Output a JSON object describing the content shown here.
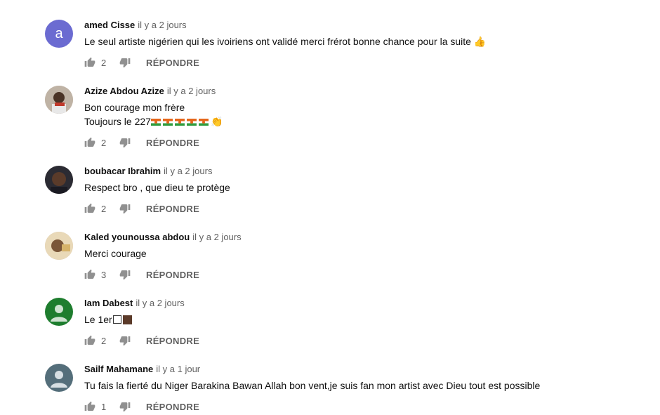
{
  "comments": [
    {
      "avatar_letter": "a",
      "author": "amed Cisse",
      "time": "il y a 2 jours",
      "lines": [
        "Le seul artiste nigérien qui les ivoiriens ont validé merci frérot bonne chance pour la suite 👍"
      ],
      "likes": "2",
      "reply": "RÉPONDRE"
    },
    {
      "author": "Azize Abdou Azize",
      "time": "il y a 2 jours",
      "lines": [
        "Bon courage mon frère",
        "Toujours le 227"
      ],
      "likes": "2",
      "reply": "RÉPONDRE"
    },
    {
      "author": "boubacar Ibrahim",
      "time": "il y a 2 jours",
      "lines": [
        "Respect bro , que dieu te protège"
      ],
      "likes": "2",
      "reply": "RÉPONDRE"
    },
    {
      "author": "Kaled younoussa abdou",
      "time": "il y a 2 jours",
      "lines": [
        "Merci courage"
      ],
      "likes": "3",
      "reply": "RÉPONDRE"
    },
    {
      "author": "Iam Dabest",
      "time": "il y a 2 jours",
      "lines": [
        "Le 1er"
      ],
      "likes": "2",
      "reply": "RÉPONDRE"
    },
    {
      "author": "Sailf Mahamane",
      "time": "il y a 1 jour",
      "lines": [
        "Tu fais la fierté du Niger Barakina Bawan Allah bon vent,je suis fan mon artist avec Dieu tout est possible"
      ],
      "likes": "1",
      "reply": "RÉPONDRE"
    }
  ],
  "emoji": {
    "clap": "👏"
  },
  "colors": {
    "letter_avatar": "#6b6bd1",
    "text_secondary": "#606060",
    "flag_orange": "#e5661b",
    "flag_green": "#2f9c3e"
  },
  "icons": [
    "thumb-up-icon",
    "thumb-down-icon",
    "default-user-icon"
  ]
}
